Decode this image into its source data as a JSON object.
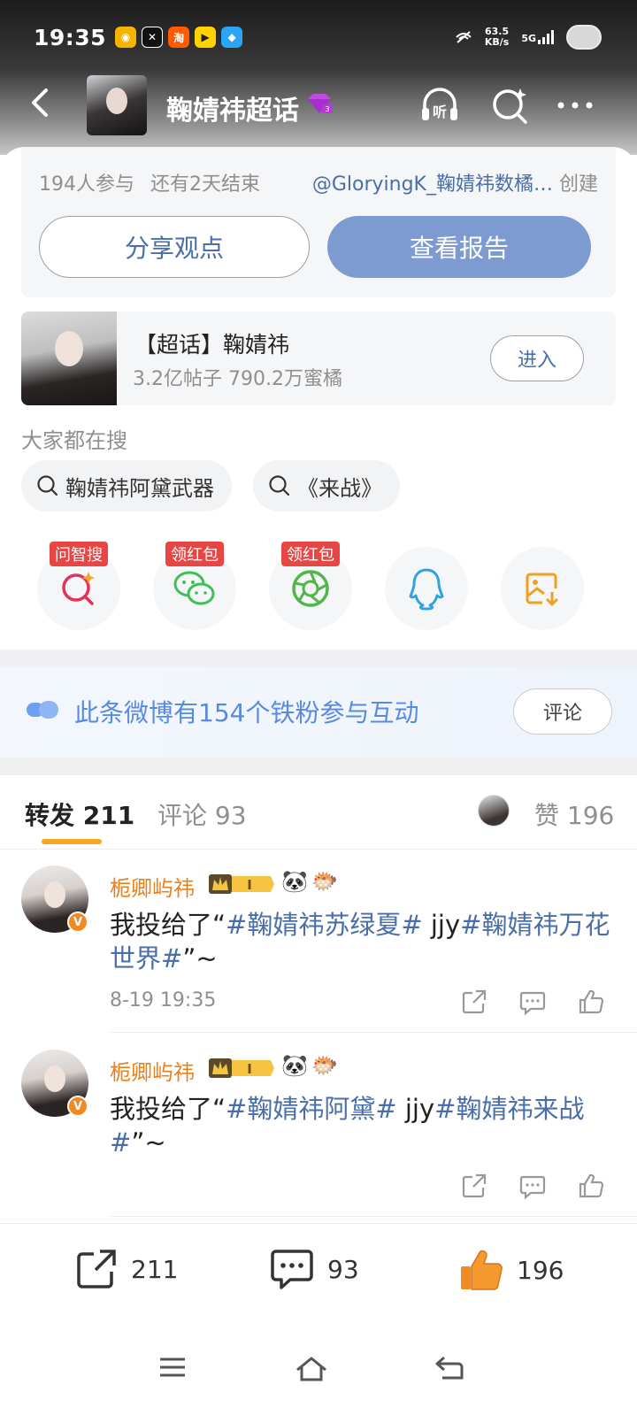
{
  "status_bar": {
    "time": "19:35",
    "speed_top": "63.5",
    "speed_bottom": "KB/s",
    "network": "5G"
  },
  "header": {
    "title": "鞠婧祎超话"
  },
  "poll": {
    "participants": "194人参与",
    "remaining": "还有2天结束",
    "creator": "@GloryingK_鞠婧祎数橘…",
    "created_label": "创建",
    "share_label": "分享观点",
    "report_label": "查看报告"
  },
  "topic": {
    "name": "【超话】鞠婧祎",
    "stats": "3.2亿帖子 790.2万蜜橘",
    "enter_label": "进入"
  },
  "search": {
    "heading": "大家都在搜",
    "chips": [
      "鞠婧祎阿黛武器",
      "《来战》"
    ]
  },
  "share_targets": {
    "badges": [
      "问智搜",
      "领红包",
      "领红包"
    ],
    "icons": [
      "ai-search-icon",
      "wechat-icon",
      "moments-icon",
      "qq-icon",
      "save-image-icon"
    ]
  },
  "fan_banner": {
    "text": "此条微博有154个铁粉参与互动",
    "button": "评论"
  },
  "tabs": {
    "repost": "转发 211",
    "comment": "评论 93",
    "like": "赞 196"
  },
  "posts": [
    {
      "name": "栀卿屿祎",
      "text_pre": "我投给了“",
      "tag1": "#鞠婧祎苏绿夏#",
      "mid": " jjy",
      "tag2": "#鞠婧祎万花世界#",
      "text_post": "”~",
      "time": "8-19 19:35"
    },
    {
      "name": "栀卿屿祎",
      "text_pre": "我投给了“",
      "tag1": "#鞠婧祎阿黛#",
      "mid": " jjy",
      "tag2": "#鞠婧祎来战#",
      "text_post": "”~",
      "time": ""
    }
  ],
  "bottom_bar": {
    "repost_count": "211",
    "comment_count": "93",
    "like_count": "196"
  },
  "colors": {
    "accent_blue": "#4a6ea9",
    "report_button": "#7e9bd1",
    "tab_underline": "#f5a623",
    "username": "#e8801c",
    "like_orange": "#f08a24"
  }
}
